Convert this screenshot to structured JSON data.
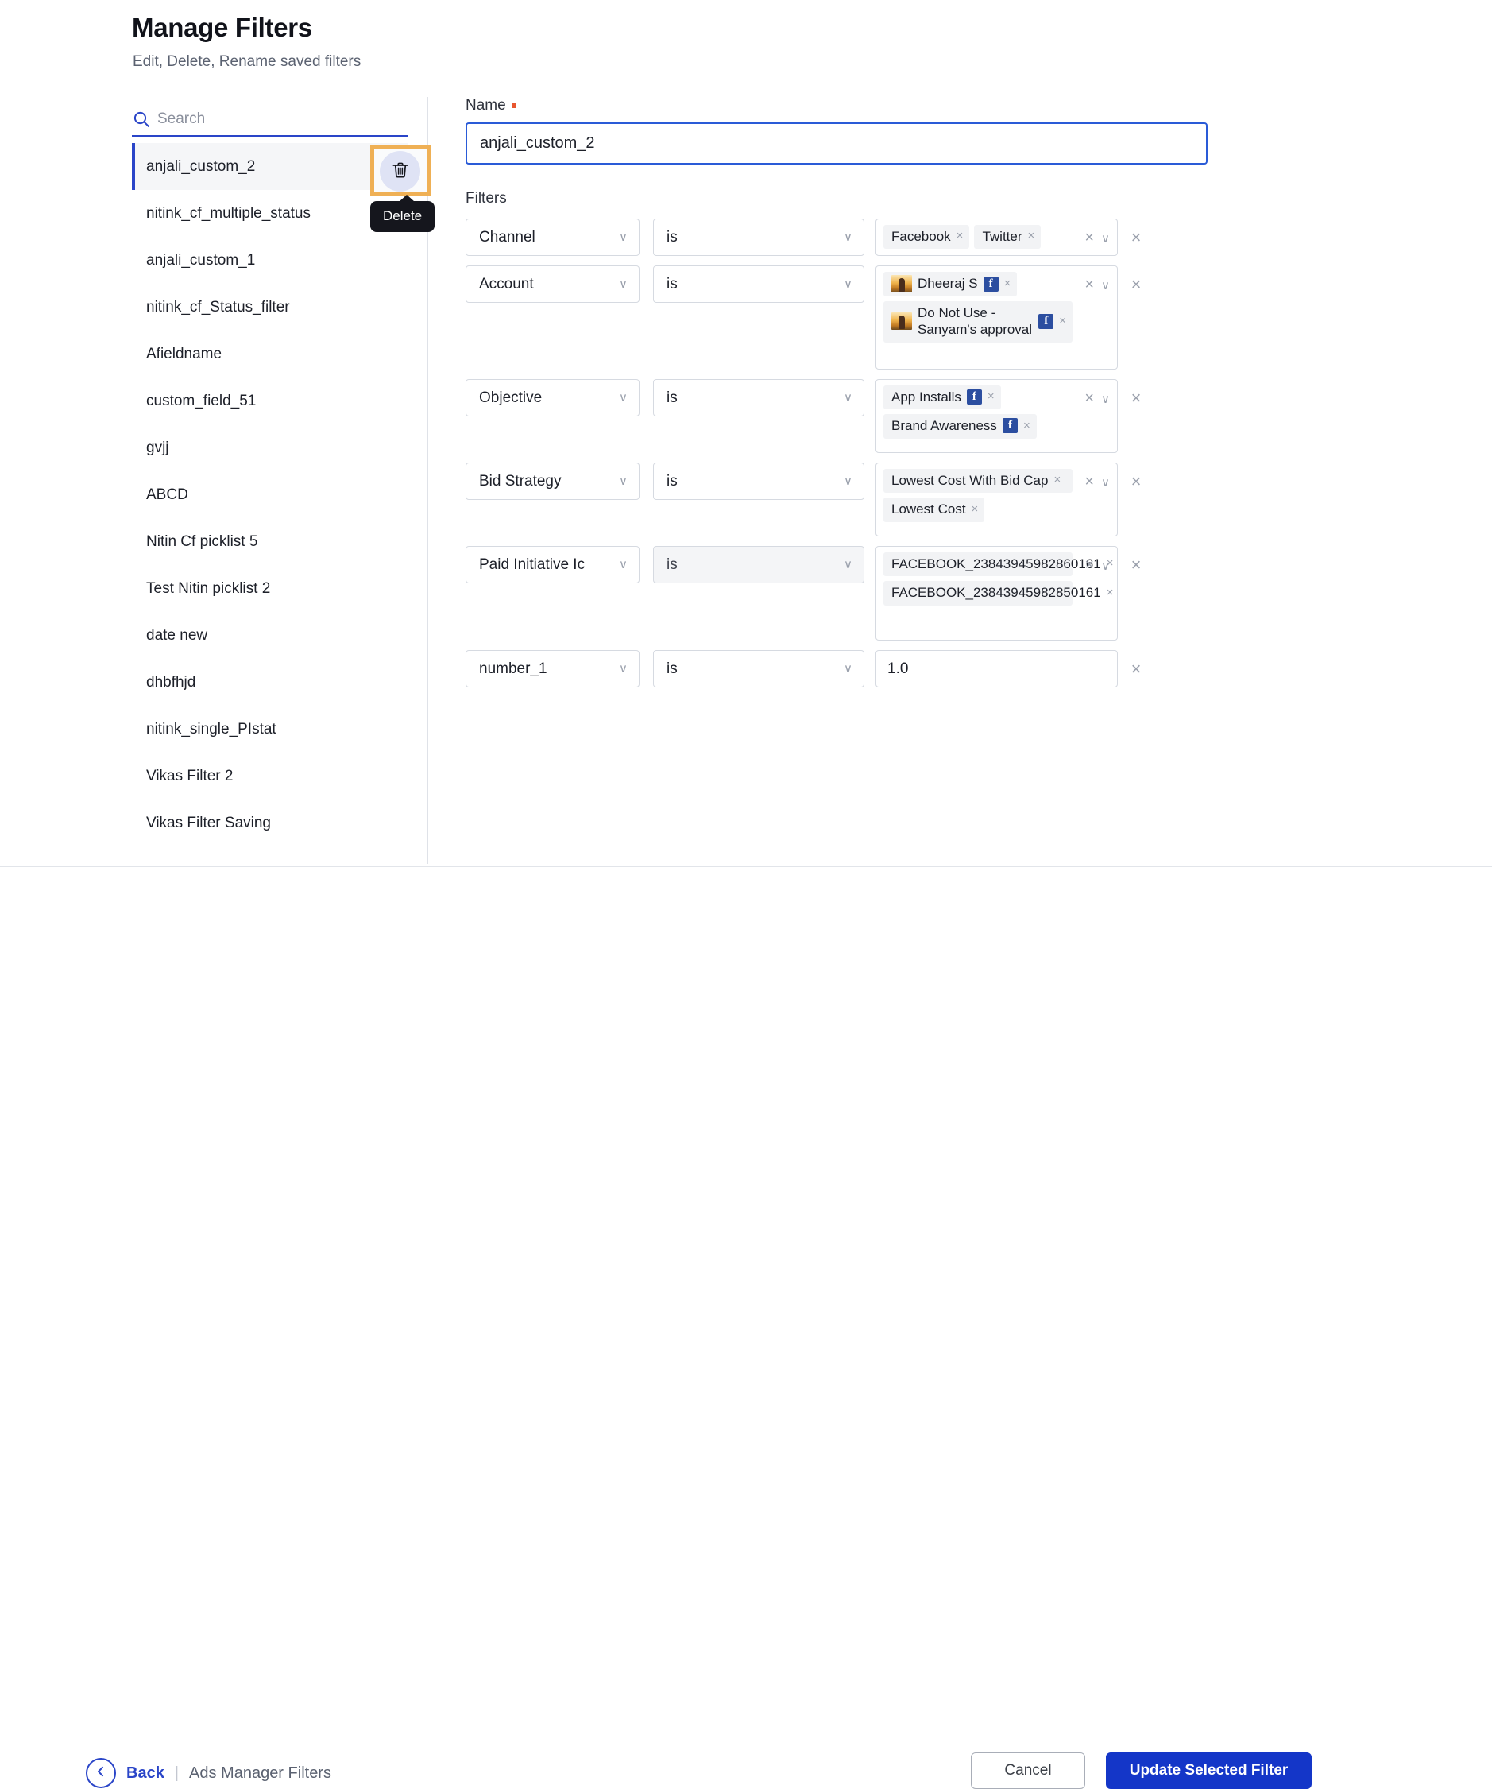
{
  "header": {
    "title": "Manage Filters",
    "subtitle": "Edit, Delete, Rename saved filters"
  },
  "sidebar": {
    "search_placeholder": "Search",
    "search_value": "",
    "items": [
      {
        "label": "anjali_custom_2",
        "selected": true
      },
      {
        "label": "nitink_cf_multiple_status",
        "selected": false
      },
      {
        "label": "anjali_custom_1",
        "selected": false
      },
      {
        "label": "nitink_cf_Status_filter",
        "selected": false
      },
      {
        "label": "Afieldname",
        "selected": false
      },
      {
        "label": "custom_field_51",
        "selected": false
      },
      {
        "label": "gvjj",
        "selected": false
      },
      {
        "label": "ABCD",
        "selected": false
      },
      {
        "label": "Nitin Cf picklist 5",
        "selected": false
      },
      {
        "label": "Test Nitin picklist 2",
        "selected": false
      },
      {
        "label": "date new",
        "selected": false
      },
      {
        "label": "dhbfhjd",
        "selected": false
      },
      {
        "label": "nitink_single_PIstat",
        "selected": false
      },
      {
        "label": "Vikas Filter 2",
        "selected": false
      },
      {
        "label": "Vikas Filter Saving",
        "selected": false
      }
    ],
    "delete_tooltip": "Delete"
  },
  "form": {
    "name_label": "Name",
    "name_value": "anjali_custom_2",
    "name_placeholder": "",
    "filters_label": "Filters",
    "rows": [
      {
        "field": "Channel",
        "operator": "is",
        "value_type": "tags",
        "tags": [
          {
            "text": "Facebook",
            "fb": false,
            "avatar": false
          },
          {
            "text": "Twitter",
            "fb": false,
            "avatar": false
          }
        ]
      },
      {
        "field": "Account",
        "operator": "is",
        "value_type": "tags",
        "tags": [
          {
            "text": "Dheeraj S",
            "fb": true,
            "avatar": true
          },
          {
            "text": "Do Not Use - Sanyam's approval",
            "fb": true,
            "avatar": true
          }
        ]
      },
      {
        "field": "Objective",
        "operator": "is",
        "value_type": "tags",
        "tags": [
          {
            "text": "App Installs",
            "fb": true,
            "avatar": false
          },
          {
            "text": "Brand Awareness",
            "fb": true,
            "avatar": false
          }
        ]
      },
      {
        "field": "Bid Strategy",
        "operator": "is",
        "value_type": "tags",
        "tags": [
          {
            "text": "Lowest Cost With Bid Cap",
            "fb": false,
            "avatar": false
          },
          {
            "text": "Lowest Cost",
            "fb": false,
            "avatar": false
          }
        ]
      },
      {
        "field": "Paid Initiative Ic",
        "operator": "is",
        "value_type": "tags",
        "operator_disabled": true,
        "tags": [
          {
            "text": "FACEBOOK_23843945982860161",
            "fb": false,
            "avatar": false
          },
          {
            "text": "FACEBOOK_23843945982850161",
            "fb": false,
            "avatar": false
          }
        ]
      },
      {
        "field": "number_1",
        "operator": "is",
        "value_type": "text",
        "value": "1.0"
      }
    ]
  },
  "footer": {
    "back_label": "Back",
    "breadcrumb_current": "Ads Manager Filters",
    "separator": "|",
    "cancel_label": "Cancel",
    "update_label": "Update Selected Filter"
  },
  "colors": {
    "accent_blue": "#2a45c8",
    "primary_button": "#1436c8",
    "highlight_orange": "#efb055",
    "required_red": "#e8562f",
    "facebook_blue": "#2c4ea0"
  }
}
